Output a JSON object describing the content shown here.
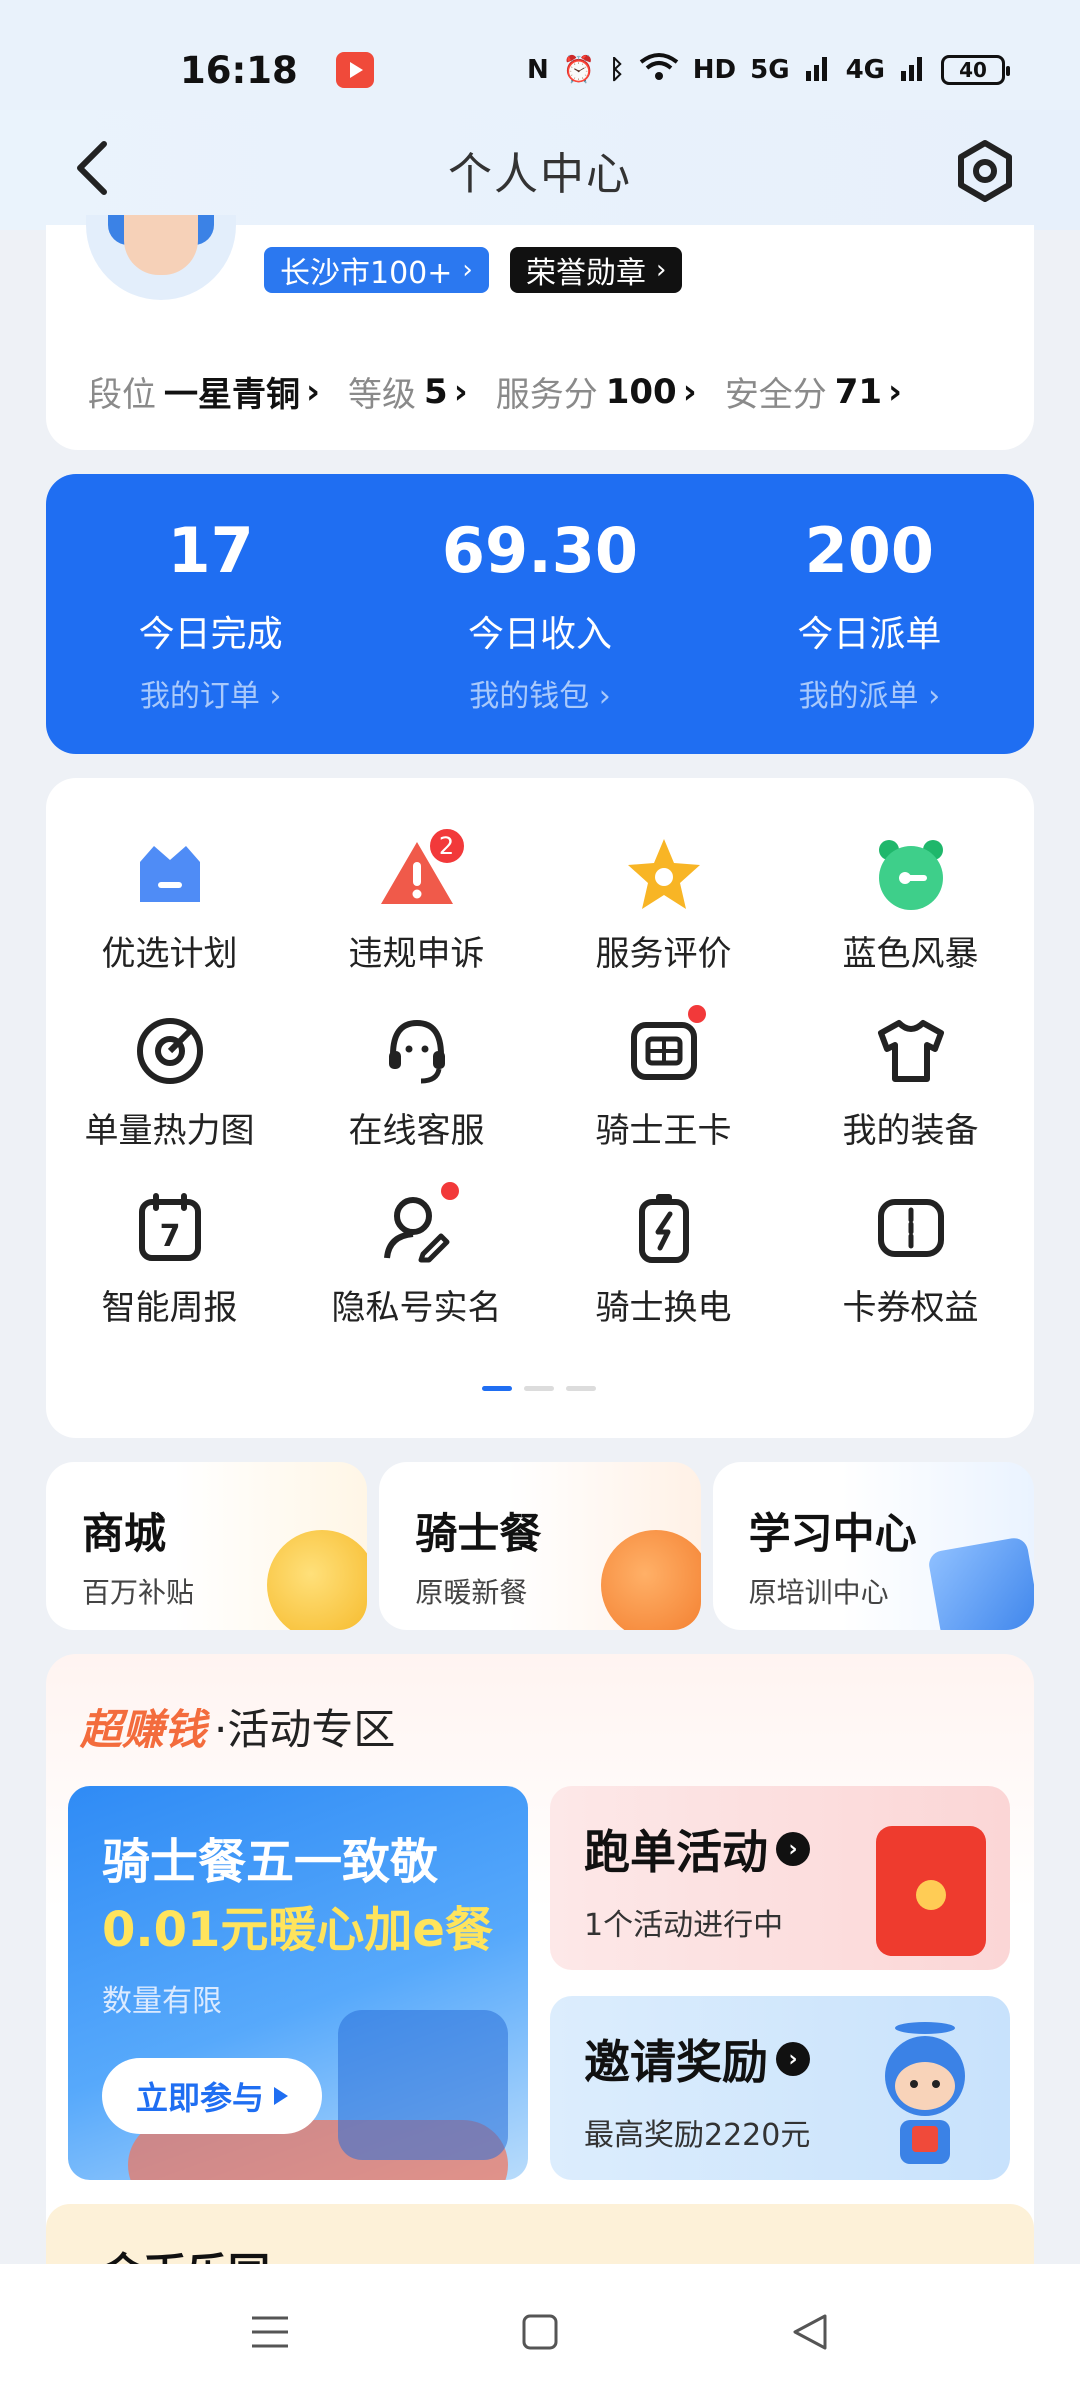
{
  "status_bar": {
    "time": "16:18",
    "network_1": "5G",
    "network_2": "4G",
    "battery": "40"
  },
  "nav": {
    "title": "个人中心",
    "back_icon": "back-chevron-icon",
    "settings_icon": "settings-hexagon-icon"
  },
  "profile": {
    "city_tag": "长沙市100+",
    "honor_tag": "荣誉勋章",
    "stats": [
      {
        "key": "段位",
        "value": "一星青铜"
      },
      {
        "key": "等级",
        "value": "5"
      },
      {
        "key": "服务分",
        "value": "100"
      },
      {
        "key": "安全分",
        "value": "71"
      }
    ]
  },
  "today": [
    {
      "number": "17",
      "label": "今日完成",
      "link": "我的订单"
    },
    {
      "number": "69.30",
      "label": "今日收入",
      "link": "我的钱包"
    },
    {
      "number": "200",
      "label": "今日派单",
      "link": "我的派单"
    }
  ],
  "grid": [
    {
      "label": "优选计划",
      "icon": "crown-icon"
    },
    {
      "label": "违规申诉",
      "icon": "warning-icon",
      "badge": "2"
    },
    {
      "label": "服务评价",
      "icon": "star-icon"
    },
    {
      "label": "蓝色风暴",
      "icon": "clock-icon"
    },
    {
      "label": "单量热力图",
      "icon": "heatmap-icon"
    },
    {
      "label": "在线客服",
      "icon": "headset-icon"
    },
    {
      "label": "骑士王卡",
      "icon": "sim-card-icon"
    },
    {
      "label": "我的装备",
      "icon": "tshirt-icon"
    },
    {
      "label": "智能周报",
      "icon": "calendar-icon",
      "calendar_day": "7"
    },
    {
      "label": "隐私号实名",
      "icon": "user-edit-icon"
    },
    {
      "label": "骑士换电",
      "icon": "battery-swap-icon"
    },
    {
      "label": "卡券权益",
      "icon": "coupon-icon"
    }
  ],
  "pager": {
    "pages": 3,
    "active": 0
  },
  "quick": [
    {
      "title": "商城",
      "sub": "百万补贴"
    },
    {
      "title": "骑士餐",
      "sub": "原暖新餐"
    },
    {
      "title": "学习中心",
      "sub": "原培训中心"
    }
  ],
  "activity": {
    "brand": "超赚钱",
    "title": "·活动专区",
    "banner": {
      "line1": "骑士餐五一致敬",
      "line2": "0.01元暖心加e餐",
      "line3": "数量有限",
      "button": "立即参与"
    },
    "cards": [
      {
        "title": "跑单活动",
        "sub": "1个活动进行中"
      },
      {
        "title": "邀请奖励",
        "sub": "最高奖励2220元"
      }
    ]
  },
  "next_section": {
    "title": "金币乐园"
  },
  "colors": {
    "primary": "#1f6ef2",
    "badge_red": "#f2393a",
    "brand_orange": "#f36c3d",
    "banner_yellow": "#ffe45c"
  }
}
